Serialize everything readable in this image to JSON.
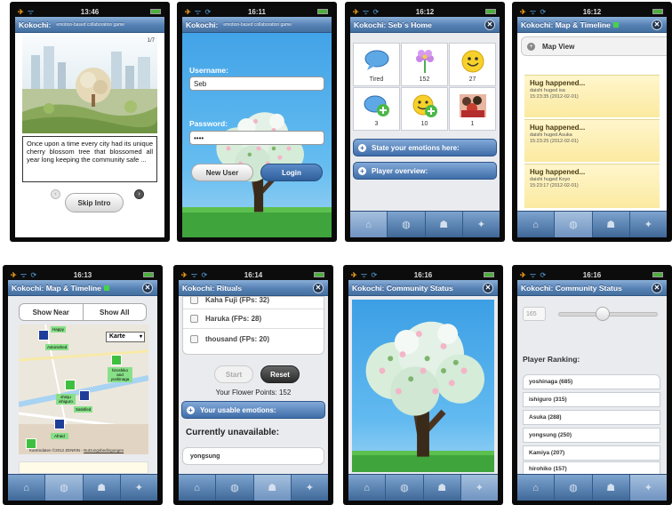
{
  "screens": [
    {
      "time": "13:46",
      "title": "Kokochi:",
      "subtitle": "emotion-based collaboration game",
      "page_counter": "1/7",
      "story": "Once upon a time every city had its unique cherry blossom tree that blossomed all year long keeping the community safe ...",
      "skip_label": "Skip Intro"
    },
    {
      "time": "16:11",
      "title": "Kokochi:",
      "subtitle": "emotion-based collaboration game",
      "username_label": "Username:",
      "username_value": "Seb",
      "password_label": "Password:",
      "password_value": "••••",
      "new_user_label": "New User",
      "login_label": "Login"
    },
    {
      "time": "16:12",
      "title": "Kokochi: Seb´s Home",
      "cells": [
        {
          "icon": "speech-bubble-icon",
          "value": "Tired"
        },
        {
          "icon": "flower-icon",
          "value": "152"
        },
        {
          "icon": "smiley-icon",
          "value": "27"
        },
        {
          "icon": "bubble-plus-icon",
          "value": "3"
        },
        {
          "icon": "smiley-plus-icon",
          "value": "10"
        },
        {
          "icon": "group-photo-icon",
          "value": "1"
        }
      ],
      "state_label": "State your emotions here:",
      "overview_label": "Player overview:"
    },
    {
      "time": "16:12",
      "title": "Kokochi: Map & Timeline",
      "map_view_label": "Map View",
      "events": [
        {
          "title": "Hug happened...",
          "detail": "daishi huged isa",
          "date": "15:23:35 (2012-02-01)"
        },
        {
          "title": "Hug happened...",
          "detail": "daishi huged Asuka",
          "date": "15:23:25 (2012-02-01)"
        },
        {
          "title": "Hug happened...",
          "detail": "daishi huged Koyo",
          "date": "15:23:17 (2012-02-01)"
        }
      ]
    },
    {
      "time": "16:13",
      "title": "Kokochi: Map & Timeline",
      "show_near": "Show Near",
      "show_all": "Show All",
      "map_type": "Karte",
      "labels": [
        "Happy",
        "Astonished",
        "hiroshiko and yoshinaga",
        "shinju ishiguro",
        "Satisfied",
        "Afraid"
      ],
      "map_credit": "Kartendaten ©2012 ZENRIN",
      "map_terms": "Nutzungsbedingungen"
    },
    {
      "time": "16:14",
      "title": "Kokochi: Rituals",
      "players": [
        "Kaha Fuji (FPs: 32)",
        "Haruka (FPs: 28)",
        "thousand (FPs: 20)"
      ],
      "start_label": "Start",
      "reset_label": "Reset",
      "flower_points": "Your Flower Points: 152",
      "usable_label": "Your usable emotions:",
      "unavailable_label": "Currently unavailable:",
      "unavailable_player": "yongsung"
    },
    {
      "time": "16:16",
      "title": "Kokochi: Community Status"
    },
    {
      "time": "16:16",
      "title": "Kokochi: Community Status",
      "slider_value": "165",
      "ranking_label": "Player Ranking:",
      "rankings": [
        "yoshinaga (685)",
        "ishiguro (315)",
        "Asuka (288)",
        "yongsung (250)",
        "Kamiya (207)",
        "hirohiko (157)"
      ]
    }
  ],
  "tabs": [
    "home-icon",
    "globe-icon",
    "hand-icon",
    "sparkle-icon"
  ],
  "colors": {
    "title_bar": "#5681b5",
    "note": "#fbeaa0",
    "sky": "#4ea9e6",
    "grass": "#3fa43c"
  }
}
